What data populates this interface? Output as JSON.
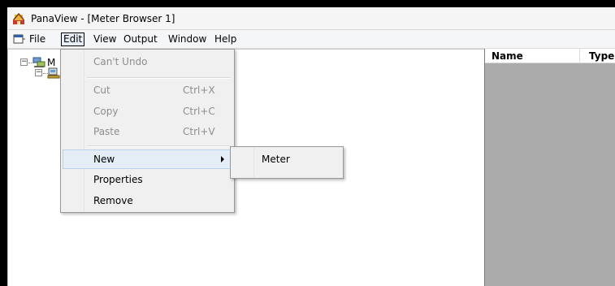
{
  "window": {
    "title": "PanaView - [Meter Browser 1]",
    "icon": "panaview-app-icon"
  },
  "menubar": {
    "icon": "document-window-icon",
    "items": [
      {
        "label": "File"
      },
      {
        "label": "Edit",
        "open": true
      },
      {
        "label": "View"
      },
      {
        "label": "Output"
      },
      {
        "label": "Window"
      },
      {
        "label": "Help"
      }
    ]
  },
  "tree": {
    "nodes": [
      {
        "label": "M",
        "icon": "network-icon",
        "expander": "−"
      },
      {
        "label": "",
        "icon": "meter-group-icon",
        "expander": "−"
      }
    ]
  },
  "list": {
    "columns": [
      {
        "label": "Name"
      },
      {
        "label": "Type"
      }
    ],
    "background_color": "#ababab"
  },
  "edit_menu": {
    "items": [
      {
        "label": "Can't Undo",
        "accel": "",
        "disabled": true
      },
      {
        "label": "Cut",
        "accel": "Ctrl+X",
        "disabled": true
      },
      {
        "label": "Copy",
        "accel": "Ctrl+C",
        "disabled": true
      },
      {
        "label": "Paste",
        "accel": "Ctrl+V",
        "disabled": true
      },
      {
        "label": "New",
        "accel": "",
        "disabled": false,
        "highlighted": true,
        "submenu": true
      },
      {
        "label": "Properties",
        "accel": "",
        "disabled": false
      },
      {
        "label": "Remove",
        "accel": "",
        "disabled": false
      }
    ]
  },
  "new_submenu": {
    "items": [
      {
        "label": "Meter"
      }
    ]
  },
  "colors": {
    "menu_highlight": "#e5edf7",
    "disabled_text": "#8d8d8d"
  }
}
